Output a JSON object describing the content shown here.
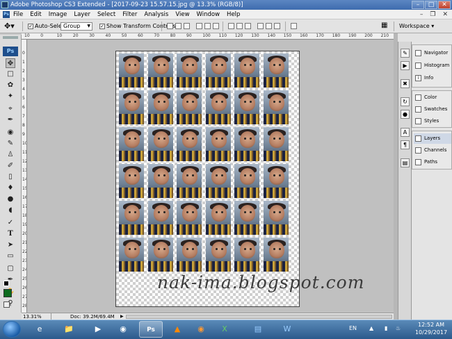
{
  "window": {
    "title": "Adobe Photoshop CS3 Extended - [2017-09-23 15.57.15.jpg @ 13.3% (RGB/8)]",
    "minimize": "–",
    "maximize": "□",
    "close": "✕"
  },
  "menu": {
    "app_icon": "Ps",
    "items": [
      "File",
      "Edit",
      "Image",
      "Layer",
      "Select",
      "Filter",
      "Analysis",
      "View",
      "Window",
      "Help"
    ],
    "doc_controls": [
      "–",
      "❐",
      "✕"
    ]
  },
  "options": {
    "auto_select_label": "Auto-Select:",
    "auto_select_checked": true,
    "auto_select_value": "Group",
    "show_transform_label": "Show Transform Controls",
    "show_transform_checked": true,
    "workspace_label": "Workspace"
  },
  "tools": {
    "badge": "Ps",
    "icons": [
      "move-icon",
      "marquee-icon",
      "lasso-icon",
      "magic-wand-icon",
      "crop-icon",
      "slice-icon",
      "healing-brush-icon",
      "brush-icon",
      "clone-stamp-icon",
      "history-brush-icon",
      "eraser-icon",
      "paint-bucket-icon",
      "blur-icon",
      "dodge-icon",
      "pen-icon",
      "type-icon",
      "path-selection-icon",
      "shape-icon",
      "notes-icon",
      "eyedropper-icon",
      "hand-icon",
      "zoom-icon"
    ],
    "foreground_color": "#000000",
    "background_color": "#0d6b1e"
  },
  "rulers": {
    "horizontal": [
      "10",
      "0",
      "10",
      "20",
      "30",
      "40",
      "50",
      "60",
      "70",
      "80",
      "90",
      "100",
      "110",
      "120",
      "130",
      "140",
      "150",
      "160",
      "170",
      "180",
      "190",
      "200",
      "210"
    ],
    "vertical": [
      "0",
      "1",
      "2",
      "3",
      "4",
      "5",
      "6",
      "7",
      "8",
      "9",
      "10",
      "11",
      "12",
      "13",
      "14",
      "15",
      "16",
      "17",
      "18",
      "19",
      "20",
      "21",
      "22",
      "23",
      "24",
      "25",
      "26",
      "27",
      "28"
    ]
  },
  "document": {
    "grid_columns": 6,
    "grid_rows": 6,
    "photo": "toddler-passport-photo"
  },
  "watermark": "nak-ima.blogspot.com",
  "status": {
    "zoom": "13.31%",
    "doc_info": "Doc: 39.2M/69.4M"
  },
  "panels": {
    "group1": [
      "Navigator",
      "Histogram",
      "Info"
    ],
    "group2": [
      "Color",
      "Swatches",
      "Styles"
    ],
    "group3": [
      "Layers",
      "Channels",
      "Paths"
    ],
    "selected": "Layers"
  },
  "taskbar": {
    "apps": [
      "internet-explorer-icon",
      "folder-icon",
      "media-player-icon",
      "chrome-icon",
      "photoshop-icon",
      "vlc-icon",
      "firefox-icon",
      "excel-icon",
      "notepad-icon",
      "word-icon"
    ],
    "open_app": "photoshop-icon",
    "language": "EN",
    "time": "12:52 AM",
    "date": "10/29/2017"
  }
}
